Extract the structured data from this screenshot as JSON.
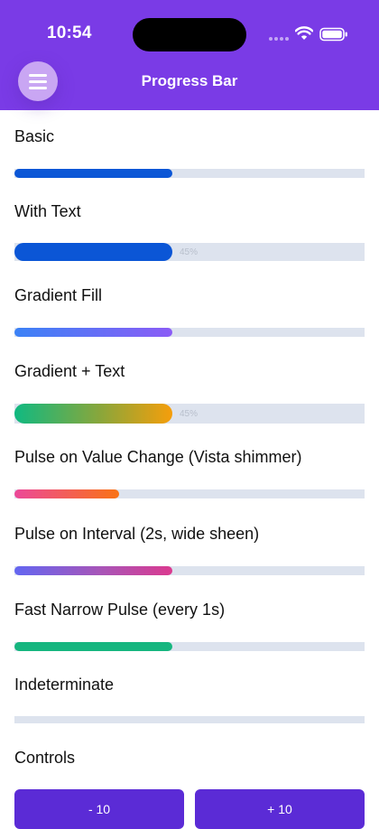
{
  "status_bar": {
    "time": "10:54"
  },
  "header": {
    "title": "Progress Bar",
    "menu_icon": "hamburger-icon"
  },
  "progress": {
    "value_percent": 45,
    "pulse_value_change_percent": 30,
    "indeterminate_percent": 0
  },
  "sections": {
    "basic": "Basic",
    "with_text": "With Text",
    "with_text_value": "45%",
    "gradient_fill": "Gradient Fill",
    "gradient_text": "Gradient + Text",
    "gradient_text_value": "45%",
    "pulse_value_change": "Pulse on Value Change (Vista shimmer)",
    "pulse_interval": "Pulse on Interval (2s, wide sheen)",
    "fast_pulse": "Fast Narrow Pulse (every 1s)",
    "indeterminate": "Indeterminate",
    "controls": "Controls"
  },
  "controls": {
    "minus_label": "- 10",
    "plus_label": "+ 10"
  },
  "colors": {
    "header": "#7a3be6",
    "solid_fill": "#0b56d6",
    "track": "#dde3ee",
    "button": "#5b2bd6",
    "green": "#16b67f"
  }
}
